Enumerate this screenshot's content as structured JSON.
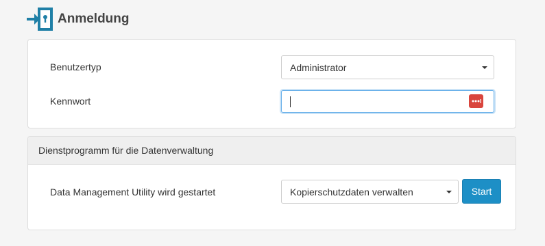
{
  "header": {
    "title": "Anmeldung",
    "icon": "login-door-icon",
    "icon_color": "#1f7fa6"
  },
  "login": {
    "user_type_label": "Benutzertyp",
    "user_type_value": "Administrator",
    "password_label": "Kennwort",
    "password_value": "",
    "password_manager_icon": "password-manager-icon",
    "password_manager_color": "#d9453d"
  },
  "dmu": {
    "heading": "Dienstprogramm für die Datenverwaltung",
    "action_label": "Data Management Utility wird gestartet",
    "action_value": "Kopierschutzdaten verwalten",
    "start_label": "Start",
    "start_color": "#1d8fc6"
  }
}
